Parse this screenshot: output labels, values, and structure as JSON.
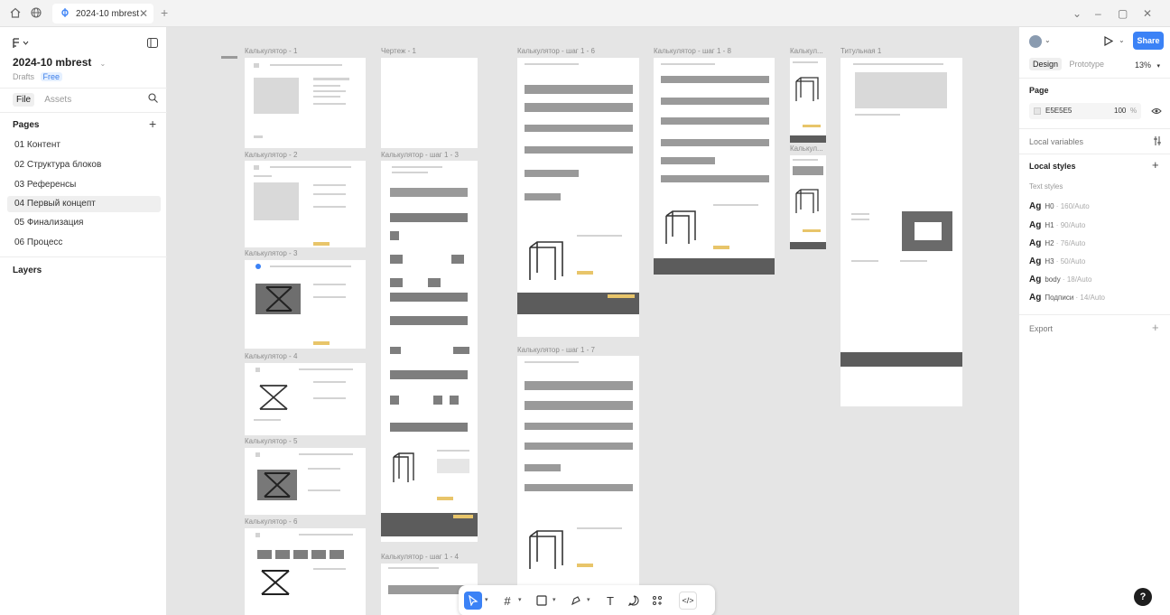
{
  "titlebar": {
    "tab_title": "2024-10 mbrest",
    "icons": [
      "home-icon",
      "globe-icon",
      "figma-logo-icon",
      "close-icon",
      "plus-icon",
      "chevron-down-icon",
      "minimize-icon",
      "maximize-icon",
      "close-window-icon"
    ]
  },
  "left_panel": {
    "file_name": "2024-10 mbrest",
    "location": "Drafts",
    "plan": "Free",
    "tab_file": "File",
    "tab_assets": "Assets",
    "pages_title": "Pages",
    "pages": [
      "01 Контент",
      "02 Структура блоков",
      "03 Референсы",
      "04 Первый концепт",
      "05 Финализация",
      "06 Процесс"
    ],
    "active_page_index": 3,
    "layers_title": "Layers"
  },
  "canvas": {
    "frame_labels": [
      "Калькулятор - 1",
      "Калькулятор - 2",
      "Калькулятор - 3",
      "Калькулятор - 4",
      "Калькулятор - 5",
      "Калькулятор - 6",
      "Чертеж - 1",
      "Калькулятор - шаг 1 - 3",
      "Калькулятор - шаг 1 - 4",
      "Калькулятор - шаг 1 - 6",
      "Калькулятор - шаг 1 - 7",
      "Калькулятор - шаг 1 - 8",
      "Калькул...",
      "Калькул...",
      "Титульная 1"
    ],
    "background": "#e5e5e5"
  },
  "toolbar": {
    "tools": [
      "move-tool-icon",
      "frame-tool-icon",
      "shape-tool-icon",
      "pen-tool-icon",
      "text-tool-icon",
      "comment-tool-icon",
      "actions-tool-icon",
      "dev-mode-icon"
    ],
    "active_tool": "move-tool-icon"
  },
  "right_panel": {
    "share_label": "Share",
    "tab_design": "Design",
    "tab_prototype": "Prototype",
    "zoom": "13%",
    "page_title": "Page",
    "page_color": "E5E5E5",
    "page_opacity": "100",
    "percent_sign": "%",
    "local_variables": "Local variables",
    "local_styles": "Local styles",
    "text_styles_title": "Text styles",
    "text_styles": [
      {
        "ag": "Ag",
        "name": "H0",
        "spec": " · 160/Auto"
      },
      {
        "ag": "Ag",
        "name": "H1",
        "spec": " · 90/Auto"
      },
      {
        "ag": "Ag",
        "name": "H2",
        "spec": " · 76/Auto"
      },
      {
        "ag": "Ag",
        "name": "H3",
        "spec": " · 50/Auto"
      },
      {
        "ag": "Ag",
        "name": "body",
        "spec": " · 18/Auto"
      },
      {
        "ag": "Ag",
        "name": "Подписи",
        "spec": " · 14/Auto"
      }
    ],
    "export_title": "Export",
    "accent_color": "#3b82f6"
  },
  "help_label": "?"
}
